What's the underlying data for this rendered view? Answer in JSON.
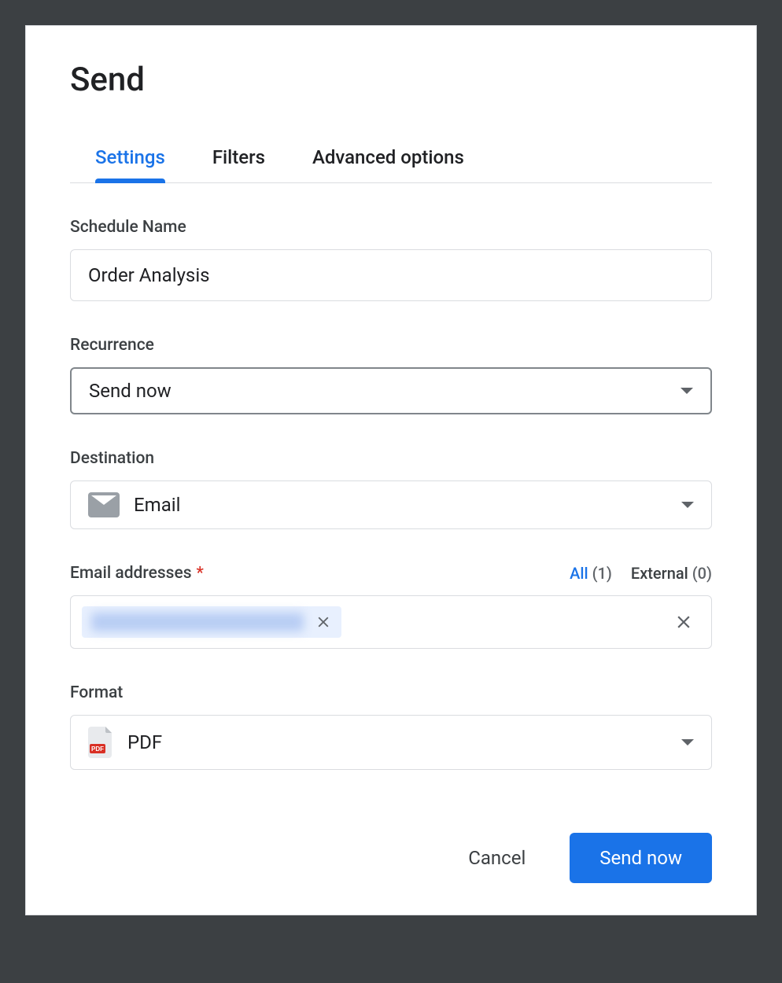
{
  "dialog": {
    "title": "Send",
    "tabs": [
      "Settings",
      "Filters",
      "Advanced options"
    ],
    "active_tab_index": 0
  },
  "fields": {
    "schedule_name": {
      "label": "Schedule Name",
      "value": "Order Analysis"
    },
    "recurrence": {
      "label": "Recurrence",
      "value": "Send now"
    },
    "destination": {
      "label": "Destination",
      "value": "Email",
      "icon": "envelope-icon"
    },
    "email_addresses": {
      "label": "Email addresses",
      "required": true,
      "counters": {
        "all": {
          "label": "All",
          "count": 1
        },
        "external": {
          "label": "External",
          "count": 0
        }
      },
      "chips": [
        {
          "display": "(redacted email)"
        }
      ]
    },
    "format": {
      "label": "Format",
      "value": "PDF",
      "icon": "pdf-icon"
    }
  },
  "footer": {
    "cancel": "Cancel",
    "submit": "Send now"
  }
}
